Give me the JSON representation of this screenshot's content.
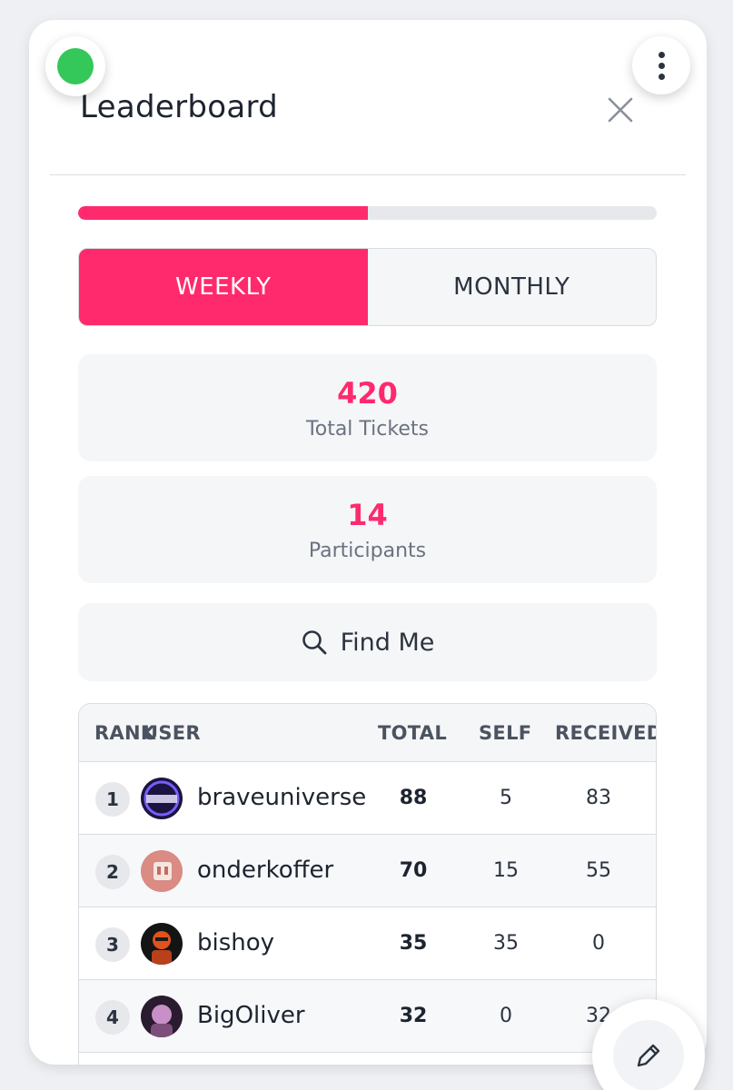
{
  "header": {
    "title": "Leaderboard"
  },
  "progress": {
    "fraction": 0.5
  },
  "tabs": [
    {
      "label": "WEEKLY",
      "active": true
    },
    {
      "label": "MONTHLY",
      "active": false
    }
  ],
  "stats": {
    "total_tickets": {
      "value": "420",
      "label": "Total Tickets"
    },
    "participants": {
      "value": "14",
      "label": "Participants"
    }
  },
  "find_me": {
    "label": "Find Me"
  },
  "table": {
    "columns": {
      "rank": "RANK",
      "user": "USER",
      "total": "TOTAL",
      "self": "SELF",
      "received": "RECEIVED"
    },
    "rows": [
      {
        "rank": "1",
        "user": "braveuniverse",
        "total": "88",
        "self": "5",
        "received": "83"
      },
      {
        "rank": "2",
        "user": "onderkoffer",
        "total": "70",
        "self": "15",
        "received": "55"
      },
      {
        "rank": "3",
        "user": "bishoy",
        "total": "35",
        "self": "35",
        "received": "0"
      },
      {
        "rank": "4",
        "user": "BigOliver",
        "total": "32",
        "self": "0",
        "received": "32"
      }
    ]
  },
  "colors": {
    "accent": "#ff2a6e",
    "status_online": "#34c759"
  },
  "icons": {
    "menu": "more-vertical-icon",
    "close": "close-icon",
    "search": "search-icon",
    "edit": "pencil-icon"
  }
}
